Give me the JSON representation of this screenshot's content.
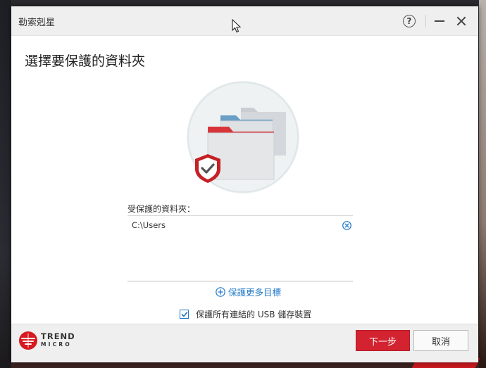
{
  "window": {
    "title": "勒索剋星"
  },
  "titlebar": {
    "help_glyph": "?"
  },
  "main": {
    "heading": "選擇要保護的資料夾",
    "folders_label": "受保護的資料夾：",
    "folders": [
      {
        "path": "C:\\Users"
      }
    ],
    "add_more_label": "保護更多目標",
    "usb_checkbox": {
      "label": "保護所有連結的 USB 儲存裝置",
      "checked": true
    }
  },
  "footer": {
    "logo_line1": "TREND",
    "logo_line2": "MICRO",
    "next_label": "下一步",
    "cancel_label": "取消"
  },
  "colors": {
    "accent_red": "#d32330",
    "link_blue": "#1f78c8"
  }
}
